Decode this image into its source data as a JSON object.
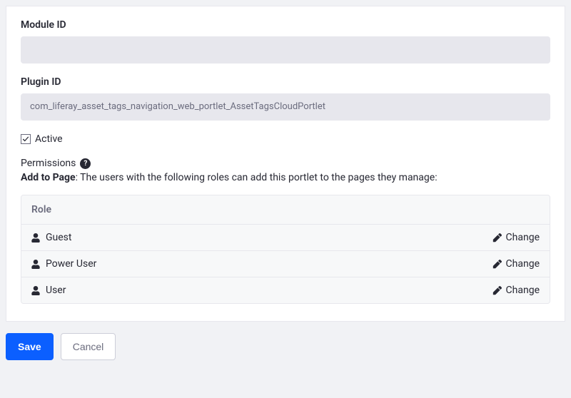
{
  "fields": {
    "module_id": {
      "label": "Module ID",
      "value": ""
    },
    "plugin_id": {
      "label": "Plugin ID",
      "value": "com_liferay_asset_tags_navigation_web_portlet_AssetTagsCloudPortlet"
    }
  },
  "active": {
    "label": "Active",
    "checked": true
  },
  "permissions": {
    "heading": "Permissions",
    "help_glyph": "?",
    "caption_label": "Add to Page",
    "caption_text": ": The users with the following roles can add this portlet to the pages they manage:",
    "table": {
      "header": "Role",
      "rows": [
        {
          "role": "Guest",
          "action": "Change"
        },
        {
          "role": "Power User",
          "action": "Change"
        },
        {
          "role": "User",
          "action": "Change"
        }
      ]
    }
  },
  "buttons": {
    "save": "Save",
    "cancel": "Cancel"
  }
}
